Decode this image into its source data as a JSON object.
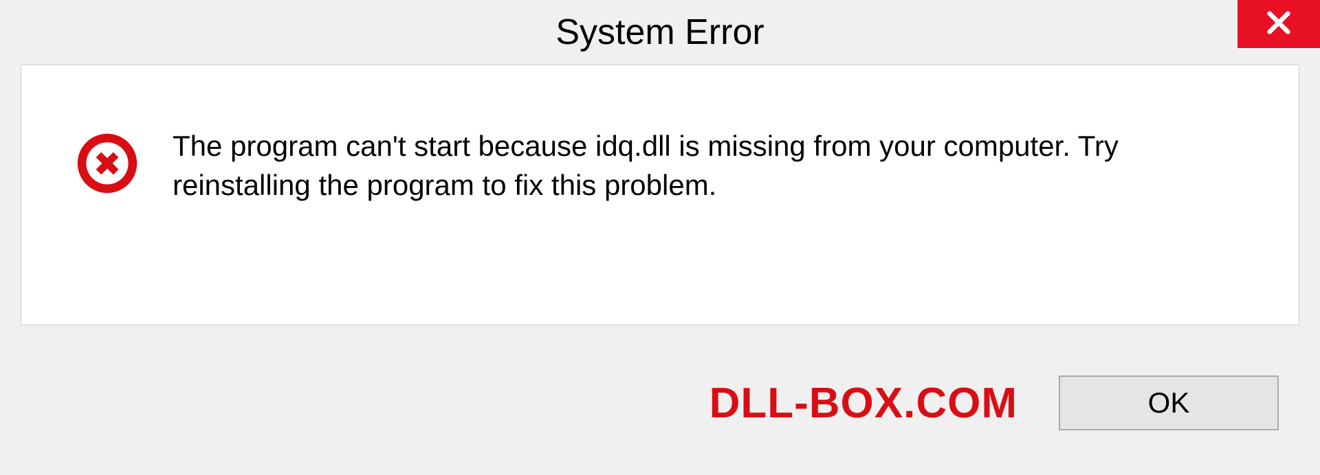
{
  "titlebar": {
    "title": "System Error"
  },
  "content": {
    "message": "The program can't start because idq.dll is missing from your computer. Try reinstalling the program to fix this problem."
  },
  "footer": {
    "watermark": "DLL-BOX.COM",
    "ok_label": "OK"
  }
}
